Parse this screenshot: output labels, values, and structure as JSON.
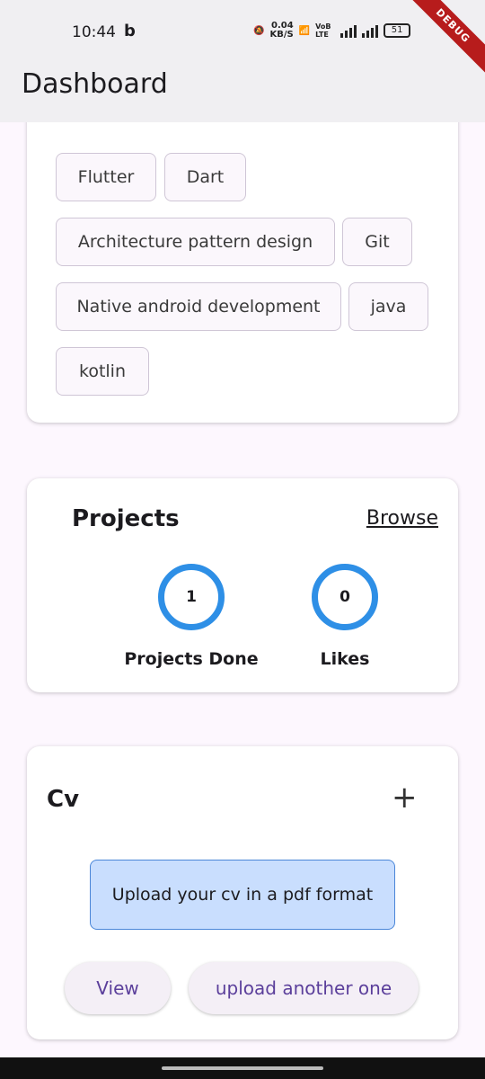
{
  "status_bar": {
    "time": "10:44",
    "app_icon": "b",
    "speed_value": "0.04",
    "speed_unit": "KB/S",
    "net_label": "VoB LTE",
    "battery": "51",
    "debug_banner": "DEBUG"
  },
  "app_bar": {
    "title": "Dashboard"
  },
  "skills": {
    "chips": [
      "Flutter",
      "Dart",
      "Architecture pattern design",
      "Git",
      "Native android development",
      "java",
      "kotlin"
    ]
  },
  "projects": {
    "title": "Projects",
    "browse_label": "Browse",
    "stats": [
      {
        "value": "1",
        "label": "Projects Done"
      },
      {
        "value": "0",
        "label": "Likes"
      }
    ],
    "ring_color": "#2e8fe6"
  },
  "cv": {
    "title": "Cv",
    "add_icon": "+",
    "upload_hint": "Upload your cv in a pdf format",
    "view_label": "View",
    "upload_another_label": "upload another one"
  }
}
